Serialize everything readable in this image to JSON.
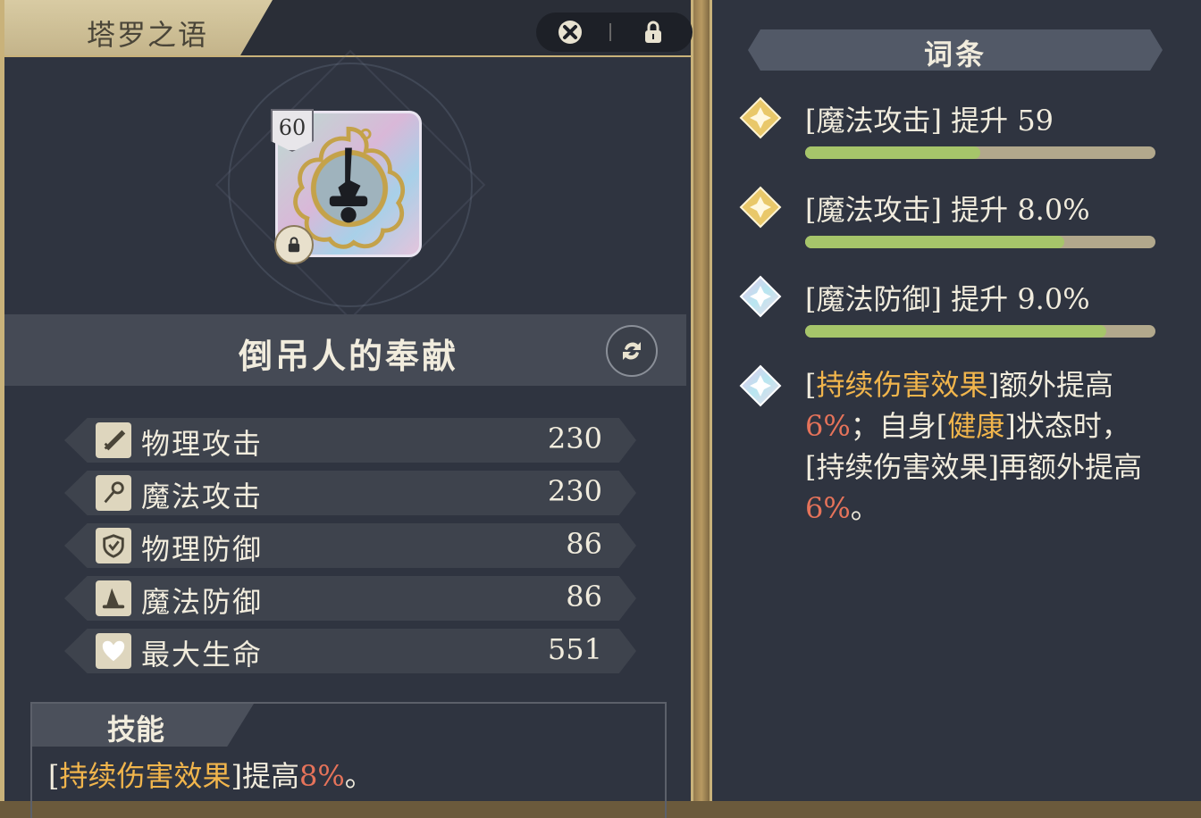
{
  "panel": {
    "title": "塔罗之语",
    "controls": {
      "discard_icon": "discard-x-icon",
      "lock_icon": "lock-icon"
    }
  },
  "item": {
    "level": "60",
    "name": "倒吊人的奉献",
    "locked": true,
    "swap_icon": "swap-icon"
  },
  "stats": [
    {
      "icon": "sword-icon",
      "label": "物理攻击",
      "value": "230"
    },
    {
      "icon": "staff-icon",
      "label": "魔法攻击",
      "value": "230"
    },
    {
      "icon": "shield-icon",
      "label": "物理防御",
      "value": "86"
    },
    {
      "icon": "wizard-hat-icon",
      "label": "魔法防御",
      "value": "86"
    },
    {
      "icon": "heart-icon",
      "label": "最大生命",
      "value": "551"
    }
  ],
  "skill": {
    "title": "技能",
    "text_parts": [
      "[",
      "持续伤害效果",
      "]提高",
      "8%",
      "。"
    ]
  },
  "affixes": {
    "title": "词条",
    "items": [
      {
        "gem": "gold",
        "text": "[魔法攻击] 提升 59",
        "progress": 0.5
      },
      {
        "gem": "gold",
        "text": "[魔法攻击] 提升 8.0%",
        "progress": 0.74
      },
      {
        "gem": "rainbow",
        "text": "[魔法防御] 提升 9.0%",
        "progress": 0.86
      }
    ],
    "special": {
      "gem": "rainbow",
      "parts": [
        "[",
        "持续伤害效果",
        "]额外提高",
        "6%",
        "；自身[",
        "健康",
        "]状态时，[持续伤害效果]再额外提高",
        "6%",
        "。"
      ]
    }
  },
  "colors": {
    "panel_bg": "#2f3440",
    "gold_trim": "#c9b27a",
    "highlight_gold": "#f1b54c",
    "highlight_orange": "#e6735a",
    "progress_green": "#a6c56a"
  }
}
